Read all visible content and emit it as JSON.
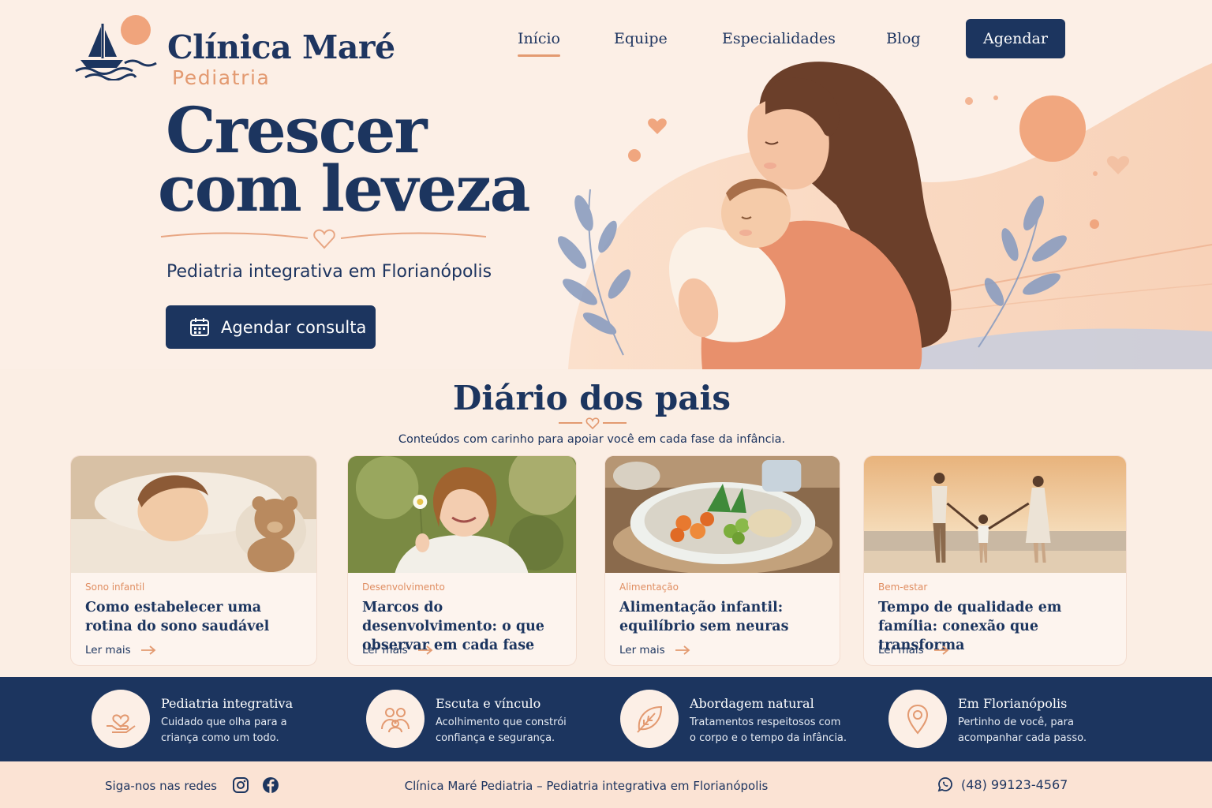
{
  "brand": {
    "name": "Clínica Maré",
    "subtitle": "Pediatria"
  },
  "nav": {
    "items": [
      {
        "label": "Início",
        "active": true
      },
      {
        "label": "Equipe",
        "active": false
      },
      {
        "label": "Especialidades",
        "active": false
      },
      {
        "label": "Blog",
        "active": false
      }
    ],
    "cta": "Agendar"
  },
  "hero": {
    "headline_line1": "Crescer",
    "headline_line2": "com leveza",
    "subtitle": "Pediatria integrativa em Florianópolis",
    "button": "Agendar consulta"
  },
  "blog": {
    "title": "Diário dos pais",
    "subtitle": "Conteúdos com carinho para apoiar você em cada fase da infância.",
    "cards": [
      {
        "category": "Sono infantil",
        "title": "Como estabelecer uma rotina do sono saudável",
        "link": "Ler mais"
      },
      {
        "category": "Desenvolvimento",
        "title": "Marcos do desenvolvimento: o que observar em cada fase",
        "link": "Ler mais"
      },
      {
        "category": "Alimentação",
        "title": "Alimentação infantil: equilíbrio sem neuras",
        "link": "Ler mais"
      },
      {
        "category": "Bem-estar",
        "title": "Tempo de qualidade em família: conexão que transforma",
        "link": "Ler mais"
      }
    ]
  },
  "features": [
    {
      "icon": "heart-hand-icon",
      "title": "Pediatria integrativa",
      "desc": "Cuidado que olha para a criança como um todo."
    },
    {
      "icon": "people-icon",
      "title": "Escuta e vínculo",
      "desc": "Acolhimento que constrói confiança e segurança."
    },
    {
      "icon": "leaf-icon",
      "title": "Abordagem natural",
      "desc": "Tratamentos respeitosos com o corpo e o tempo da infância."
    },
    {
      "icon": "map-pin-icon",
      "title": "Em Florianópolis",
      "desc": "Pertinho de você, para acompanhar cada passo."
    }
  ],
  "footer": {
    "follow": "Siga-nos nas redes",
    "social": [
      "instagram-icon",
      "facebook-icon"
    ],
    "center": "Clínica Maré Pediatria – Pediatria integrativa em Florianópolis",
    "phone": "(48) 99123-4567"
  },
  "colors": {
    "navy": "#1c355f",
    "peach": "#e39a71",
    "cream": "#fcefe6"
  }
}
